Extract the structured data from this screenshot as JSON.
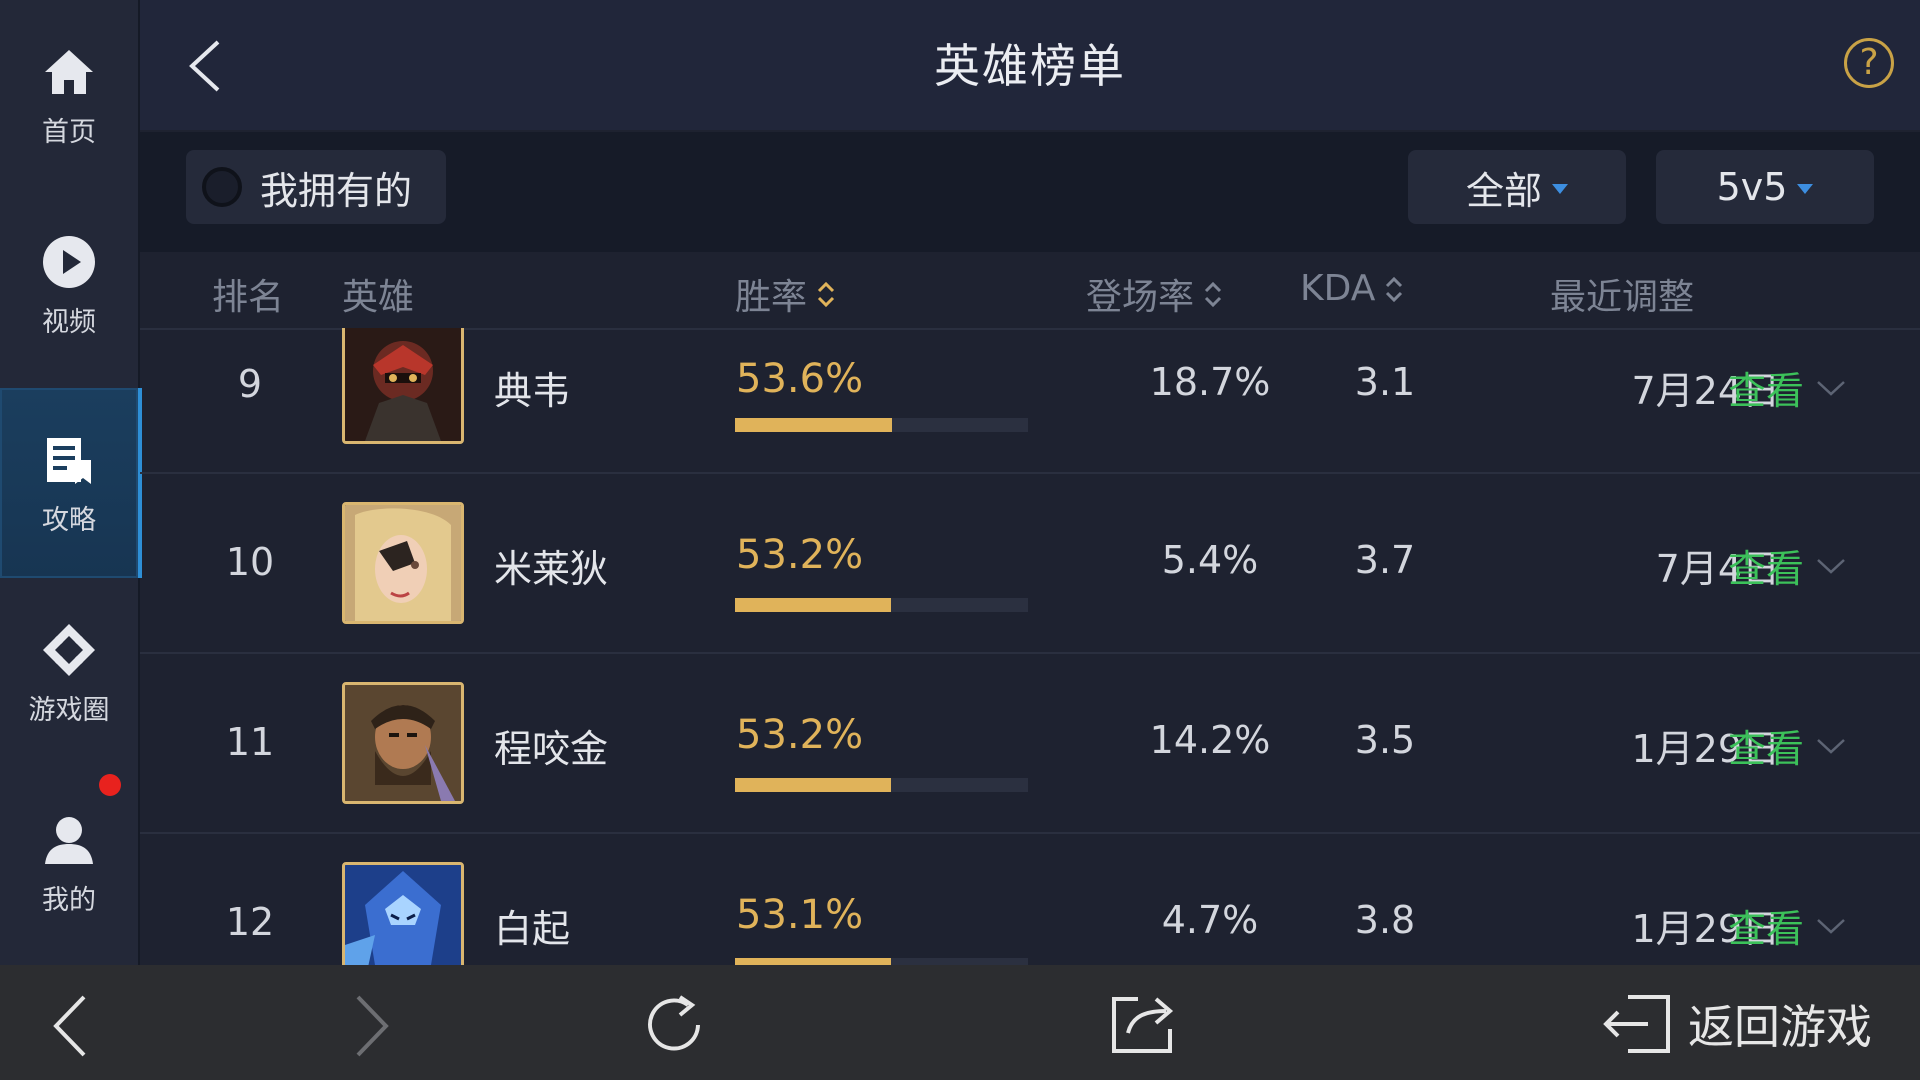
{
  "sidebar": {
    "items": [
      {
        "label": "首页",
        "icon": "home-icon"
      },
      {
        "label": "视频",
        "icon": "play-icon"
      },
      {
        "label": "攻略",
        "icon": "guide-icon",
        "active": true
      },
      {
        "label": "游戏圈",
        "icon": "game-circle-icon"
      },
      {
        "label": "我的",
        "icon": "user-icon",
        "badge": "red-dot"
      }
    ]
  },
  "header": {
    "title": "英雄榜单",
    "help_label": "?"
  },
  "filters": {
    "owned_label": "我拥有的",
    "category": "全部",
    "mode": "5v5"
  },
  "table": {
    "columns": {
      "rank": "排名",
      "hero": "英雄",
      "win_rate": "胜率",
      "pick_rate": "登场率",
      "kda": "KDA",
      "updated": "最近调整"
    },
    "rows": [
      {
        "rank": "9",
        "hero": "典韦",
        "win_rate": "53.6%",
        "win_bar": 0.535,
        "pick_rate": "18.7%",
        "kda": "3.1",
        "updated": "7月24日",
        "action": "查看"
      },
      {
        "rank": "10",
        "hero": "米莱狄",
        "win_rate": "53.2%",
        "win_bar": 0.532,
        "pick_rate": "5.4%",
        "kda": "3.7",
        "updated": "7月4日",
        "action": "查看"
      },
      {
        "rank": "11",
        "hero": "程咬金",
        "win_rate": "53.2%",
        "win_bar": 0.532,
        "pick_rate": "14.2%",
        "kda": "3.5",
        "updated": "1月29日",
        "action": "查看"
      },
      {
        "rank": "12",
        "hero": "白起",
        "win_rate": "53.1%",
        "win_bar": 0.531,
        "pick_rate": "4.7%",
        "kda": "3.8",
        "updated": "1月29日",
        "action": "查看"
      }
    ]
  },
  "bottom_bar": {
    "return_label": "返回游戏"
  },
  "colors": {
    "accent_gold": "#e0b35a",
    "link_green": "#3cc15a",
    "active_blue": "#2e8fd6",
    "badge_red": "#e8221e"
  }
}
